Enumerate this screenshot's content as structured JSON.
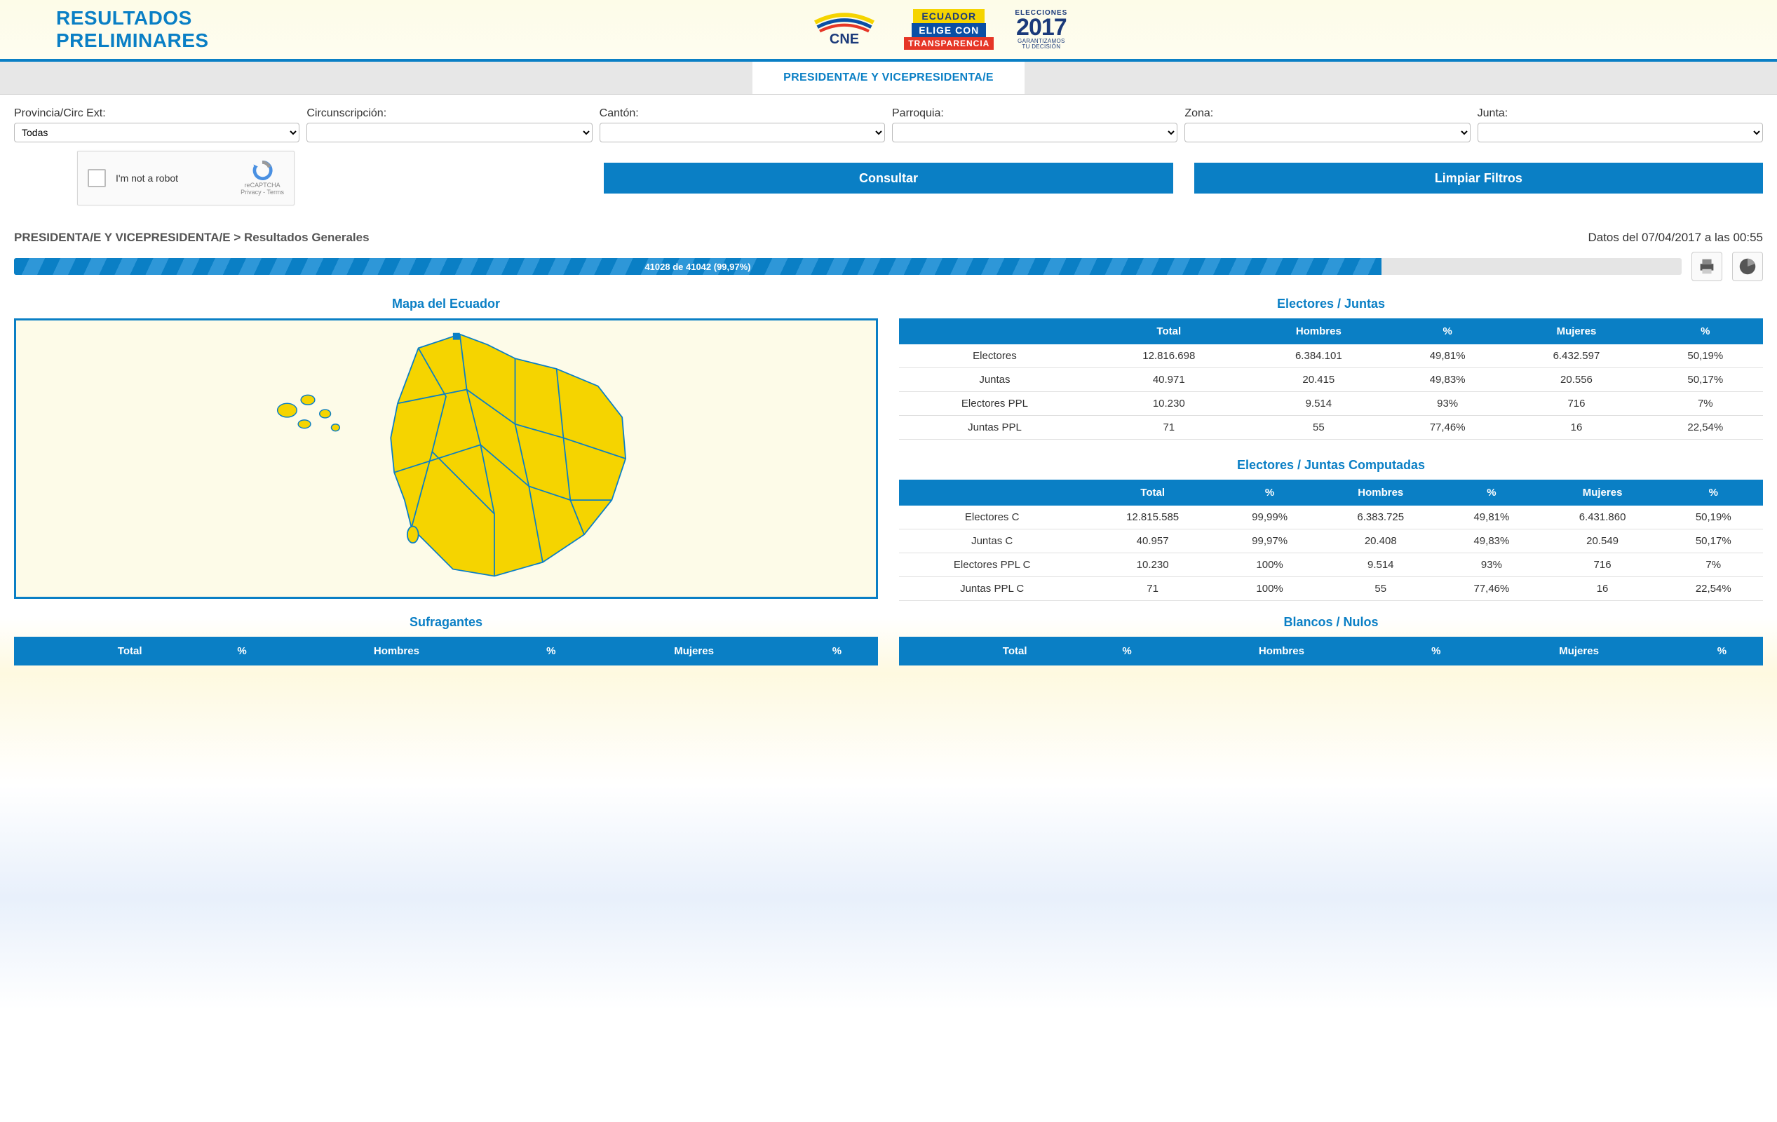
{
  "header": {
    "title_line1": "RESULTADOS",
    "title_line2": "PRELIMINARES",
    "eligecon_l1": "ECUADOR",
    "eligecon_l2": "ELIGE CON",
    "eligecon_l3": "TRANSPARENCIA",
    "elec_label": "ELECCIONES",
    "year": "2017",
    "year_sub1": "GARANTIZAMOS",
    "year_sub2": "TU DECISIÓN"
  },
  "tab": {
    "label": "PRESIDENTA/E Y VICEPRESIDENTA/E"
  },
  "filters": {
    "provincia_label": "Provincia/Circ Ext:",
    "provincia_value": "Todas",
    "circunscripcion_label": "Circunscripción:",
    "canton_label": "Cantón:",
    "parroquia_label": "Parroquia:",
    "zona_label": "Zona:",
    "junta_label": "Junta:"
  },
  "captcha": {
    "label": "I'm not a robot",
    "brand": "reCAPTCHA",
    "terms": "Privacy - Terms"
  },
  "buttons": {
    "consultar": "Consultar",
    "limpiar": "Limpiar Filtros"
  },
  "breadcrumb": {
    "path": "PRESIDENTA/E Y VICEPRESIDENTA/E > Resultados Generales",
    "timestamp": "Datos del 07/04/2017 a las 00:55"
  },
  "progress": {
    "text": "41028 de 41042 (99,97%)"
  },
  "sections": {
    "map_title": "Mapa del Ecuador",
    "electores_title": "Electores / Juntas",
    "computadas_title": "Electores / Juntas Computadas",
    "sufragantes_title": "Sufragantes",
    "blancos_title": "Blancos / Nulos"
  },
  "table1": {
    "headers": [
      "",
      "Total",
      "Hombres",
      "%",
      "Mujeres",
      "%"
    ],
    "rows": [
      {
        "label": "Electores",
        "total": "12.816.698",
        "hombres": "6.384.101",
        "hp": "49,81%",
        "mujeres": "6.432.597",
        "mp": "50,19%"
      },
      {
        "label": "Juntas",
        "total": "40.971",
        "hombres": "20.415",
        "hp": "49,83%",
        "mujeres": "20.556",
        "mp": "50,17%"
      },
      {
        "label": "Electores PPL",
        "total": "10.230",
        "hombres": "9.514",
        "hp": "93%",
        "mujeres": "716",
        "mp": "7%"
      },
      {
        "label": "Juntas PPL",
        "total": "71",
        "hombres": "55",
        "hp": "77,46%",
        "mujeres": "16",
        "mp": "22,54%"
      }
    ]
  },
  "table2": {
    "headers": [
      "",
      "Total",
      "%",
      "Hombres",
      "%",
      "Mujeres",
      "%"
    ],
    "rows": [
      {
        "label": "Electores C",
        "total": "12.815.585",
        "tp": "99,99%",
        "hombres": "6.383.725",
        "hp": "49,81%",
        "mujeres": "6.431.860",
        "mp": "50,19%"
      },
      {
        "label": "Juntas C",
        "total": "40.957",
        "tp": "99,97%",
        "hombres": "20.408",
        "hp": "49,83%",
        "mujeres": "20.549",
        "mp": "50,17%"
      },
      {
        "label": "Electores PPL C",
        "total": "10.230",
        "tp": "100%",
        "hombres": "9.514",
        "hp": "93%",
        "mujeres": "716",
        "mp": "7%"
      },
      {
        "label": "Juntas PPL C",
        "total": "71",
        "tp": "100%",
        "hombres": "55",
        "hp": "77,46%",
        "mujeres": "16",
        "mp": "22,54%"
      }
    ]
  },
  "table3_headers": [
    "",
    "Total",
    "%",
    "Hombres",
    "%",
    "Mujeres",
    "%"
  ]
}
